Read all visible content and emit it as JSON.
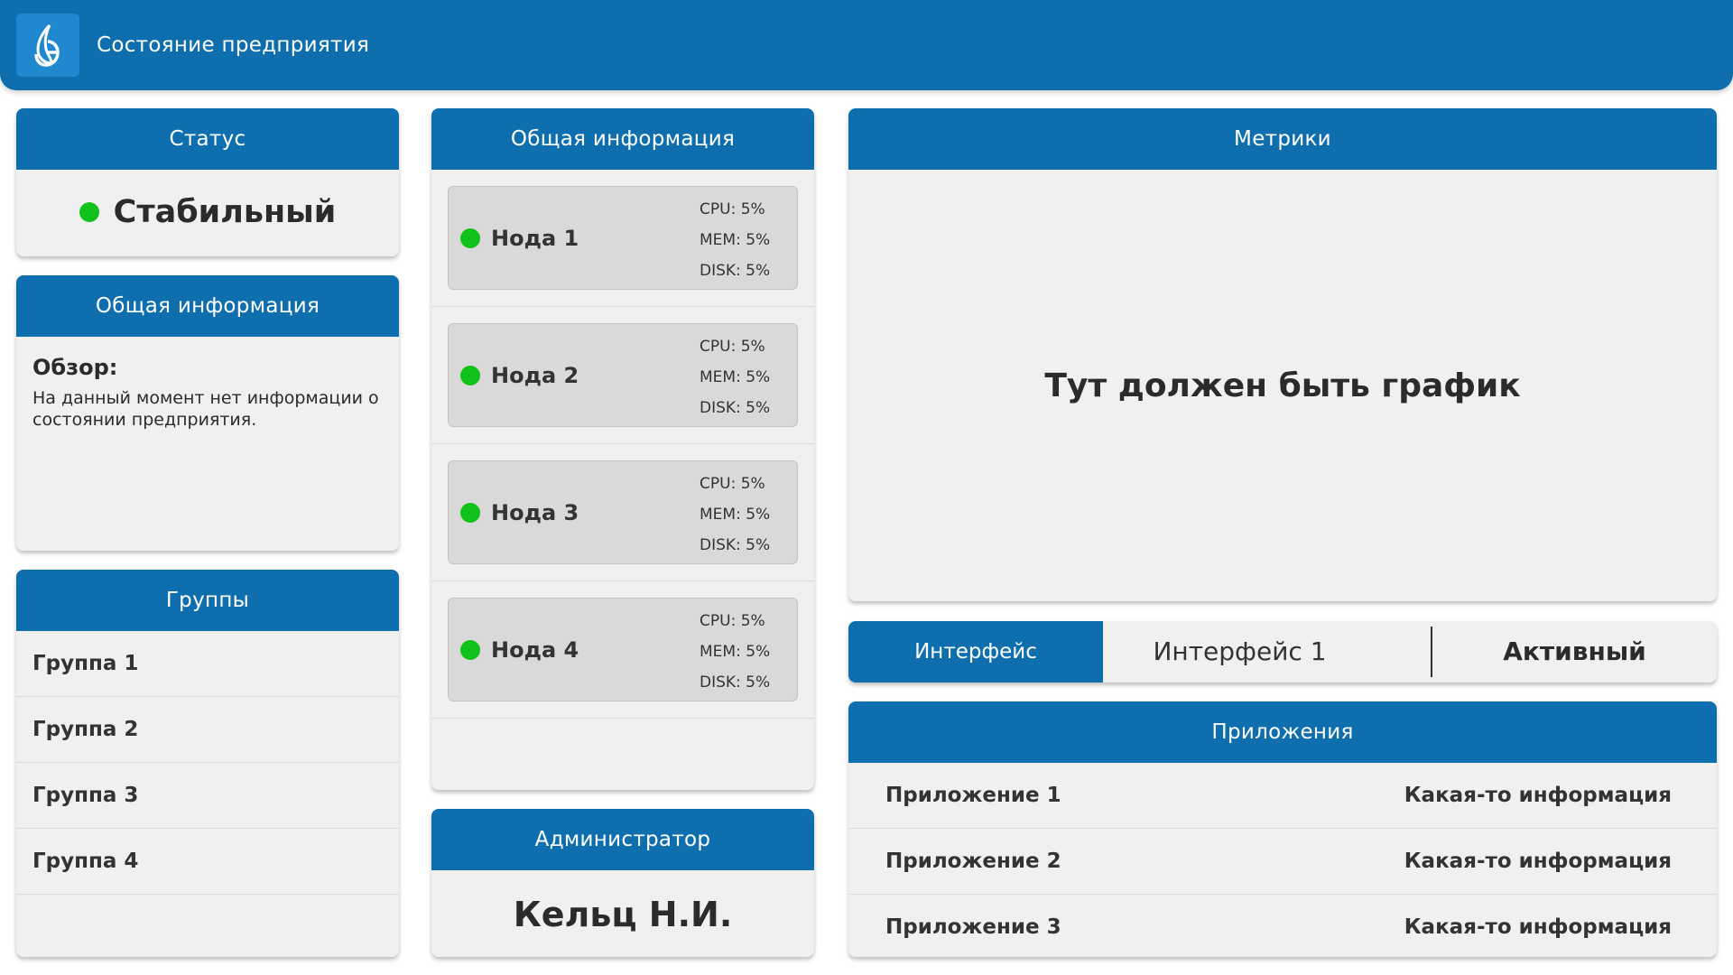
{
  "header": {
    "title": "Состояние предприятия",
    "logo_icon": "gazprom-flame-logo"
  },
  "status": {
    "header": "Статус",
    "value": "Стабильный",
    "color": "#11c11c"
  },
  "overview": {
    "header": "Общая информация",
    "title": "Обзор:",
    "text": "На данный момент нет информации о состоянии предприятия."
  },
  "groups": {
    "header": "Группы",
    "items": [
      "Группа 1",
      "Группа 2",
      "Группа 3",
      "Группа 4"
    ]
  },
  "nodes": {
    "header": "Общая информация",
    "items": [
      {
        "name": "Нода 1",
        "cpu": "CPU: 5%",
        "mem": "MEM: 5%",
        "disk": "DISK: 5%"
      },
      {
        "name": "Нода 2",
        "cpu": "CPU: 5%",
        "mem": "MEM: 5%",
        "disk": "DISK: 5%"
      },
      {
        "name": "Нода 3",
        "cpu": "CPU: 5%",
        "mem": "MEM: 5%",
        "disk": "DISK: 5%"
      },
      {
        "name": "Нода 4",
        "cpu": "CPU: 5%",
        "mem": "MEM: 5%",
        "disk": "DISK: 5%"
      }
    ]
  },
  "admin": {
    "header": "Администратор",
    "name": "Кельц Н.И."
  },
  "metrics": {
    "header": "Метрики",
    "placeholder": "Тут должен быть график"
  },
  "interface": {
    "label": "Интерфейс",
    "name": "Интерфейс 1",
    "state": "Активный"
  },
  "applications": {
    "header": "Приложения",
    "items": [
      {
        "name": "Приложение 1",
        "info": "Какая-то информация"
      },
      {
        "name": "Приложение 2",
        "info": "Какая-то информация"
      },
      {
        "name": "Приложение 3",
        "info": "Какая-то информация"
      }
    ]
  },
  "colors": {
    "primary": "#0f6fae",
    "card_bg": "#f0f0f0",
    "ok": "#11c11c"
  }
}
